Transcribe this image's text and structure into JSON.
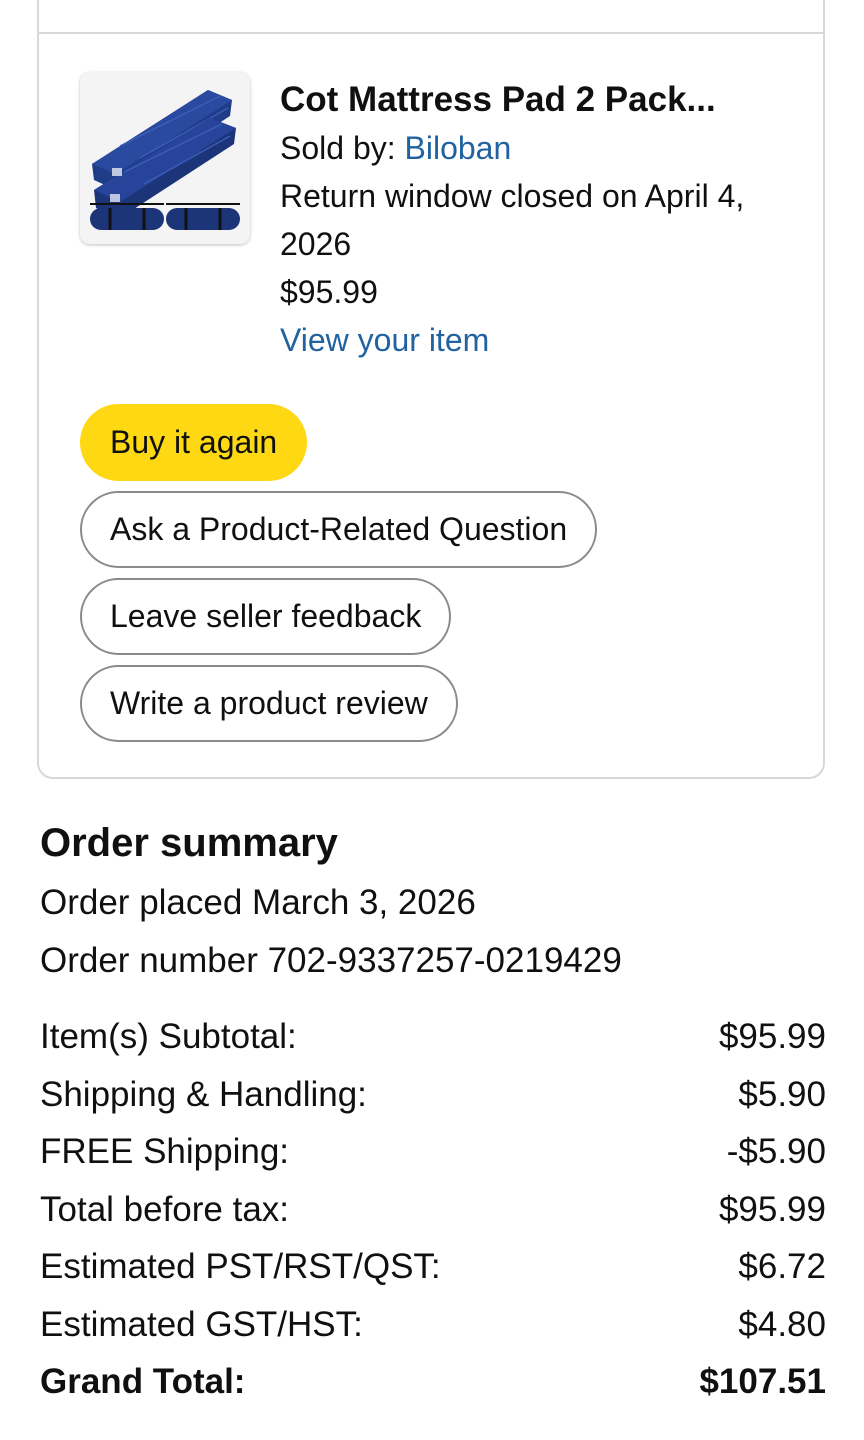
{
  "item": {
    "title": "Cot Mattress Pad 2 Pack...",
    "sold_by_label": "Sold by: ",
    "seller": "Biloban",
    "return_window_line1": "Return window closed on April 4,",
    "return_window_line2": "2026",
    "price": "$95.99",
    "view_item_label": "View your item",
    "thumbnail_icon": "mattress-pad-product-image",
    "thumbnail_color": "#1f3c88"
  },
  "actions": {
    "buy_again": "Buy it again",
    "ask_question": "Ask a Product-Related Question",
    "seller_feedback": "Leave seller feedback",
    "product_review": "Write a product review"
  },
  "summary": {
    "title": "Order summary",
    "order_placed": "Order placed March 3, 2026",
    "order_number": "Order number 702-9337257-0219429",
    "rows": [
      {
        "label": "Item(s) Subtotal:",
        "value": "$95.99"
      },
      {
        "label": "Shipping & Handling:",
        "value": "$5.90"
      },
      {
        "label": "FREE Shipping:",
        "value": "-$5.90"
      },
      {
        "label": "Total before tax:",
        "value": "$95.99"
      },
      {
        "label": "Estimated PST/RST/QST:",
        "value": "$6.72"
      },
      {
        "label": "Estimated GST/HST:",
        "value": "$4.80"
      }
    ],
    "grand_total_label": "Grand Total:",
    "grand_total_value": "$107.51"
  },
  "colors": {
    "link": "#2162a1",
    "primary_button": "#ffd814",
    "border": "#d5d9d9",
    "outline_button_border": "#888c8c"
  }
}
